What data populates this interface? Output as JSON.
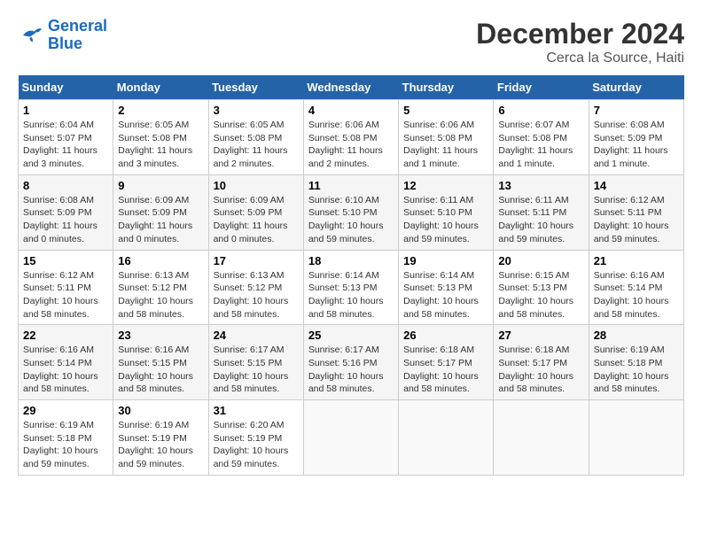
{
  "header": {
    "logo_line1": "General",
    "logo_line2": "Blue",
    "month": "December 2024",
    "location": "Cerca la Source, Haiti"
  },
  "days_of_week": [
    "Sunday",
    "Monday",
    "Tuesday",
    "Wednesday",
    "Thursday",
    "Friday",
    "Saturday"
  ],
  "weeks": [
    [
      {
        "num": "1",
        "sunrise": "6:04 AM",
        "sunset": "5:07 PM",
        "daylight": "11 hours and 3 minutes."
      },
      {
        "num": "2",
        "sunrise": "6:05 AM",
        "sunset": "5:08 PM",
        "daylight": "11 hours and 3 minutes."
      },
      {
        "num": "3",
        "sunrise": "6:05 AM",
        "sunset": "5:08 PM",
        "daylight": "11 hours and 2 minutes."
      },
      {
        "num": "4",
        "sunrise": "6:06 AM",
        "sunset": "5:08 PM",
        "daylight": "11 hours and 2 minutes."
      },
      {
        "num": "5",
        "sunrise": "6:06 AM",
        "sunset": "5:08 PM",
        "daylight": "11 hours and 1 minute."
      },
      {
        "num": "6",
        "sunrise": "6:07 AM",
        "sunset": "5:08 PM",
        "daylight": "11 hours and 1 minute."
      },
      {
        "num": "7",
        "sunrise": "6:08 AM",
        "sunset": "5:09 PM",
        "daylight": "11 hours and 1 minute."
      }
    ],
    [
      {
        "num": "8",
        "sunrise": "6:08 AM",
        "sunset": "5:09 PM",
        "daylight": "11 hours and 0 minutes."
      },
      {
        "num": "9",
        "sunrise": "6:09 AM",
        "sunset": "5:09 PM",
        "daylight": "11 hours and 0 minutes."
      },
      {
        "num": "10",
        "sunrise": "6:09 AM",
        "sunset": "5:09 PM",
        "daylight": "11 hours and 0 minutes."
      },
      {
        "num": "11",
        "sunrise": "6:10 AM",
        "sunset": "5:10 PM",
        "daylight": "10 hours and 59 minutes."
      },
      {
        "num": "12",
        "sunrise": "6:11 AM",
        "sunset": "5:10 PM",
        "daylight": "10 hours and 59 minutes."
      },
      {
        "num": "13",
        "sunrise": "6:11 AM",
        "sunset": "5:11 PM",
        "daylight": "10 hours and 59 minutes."
      },
      {
        "num": "14",
        "sunrise": "6:12 AM",
        "sunset": "5:11 PM",
        "daylight": "10 hours and 59 minutes."
      }
    ],
    [
      {
        "num": "15",
        "sunrise": "6:12 AM",
        "sunset": "5:11 PM",
        "daylight": "10 hours and 58 minutes."
      },
      {
        "num": "16",
        "sunrise": "6:13 AM",
        "sunset": "5:12 PM",
        "daylight": "10 hours and 58 minutes."
      },
      {
        "num": "17",
        "sunrise": "6:13 AM",
        "sunset": "5:12 PM",
        "daylight": "10 hours and 58 minutes."
      },
      {
        "num": "18",
        "sunrise": "6:14 AM",
        "sunset": "5:13 PM",
        "daylight": "10 hours and 58 minutes."
      },
      {
        "num": "19",
        "sunrise": "6:14 AM",
        "sunset": "5:13 PM",
        "daylight": "10 hours and 58 minutes."
      },
      {
        "num": "20",
        "sunrise": "6:15 AM",
        "sunset": "5:13 PM",
        "daylight": "10 hours and 58 minutes."
      },
      {
        "num": "21",
        "sunrise": "6:16 AM",
        "sunset": "5:14 PM",
        "daylight": "10 hours and 58 minutes."
      }
    ],
    [
      {
        "num": "22",
        "sunrise": "6:16 AM",
        "sunset": "5:14 PM",
        "daylight": "10 hours and 58 minutes."
      },
      {
        "num": "23",
        "sunrise": "6:16 AM",
        "sunset": "5:15 PM",
        "daylight": "10 hours and 58 minutes."
      },
      {
        "num": "24",
        "sunrise": "6:17 AM",
        "sunset": "5:15 PM",
        "daylight": "10 hours and 58 minutes."
      },
      {
        "num": "25",
        "sunrise": "6:17 AM",
        "sunset": "5:16 PM",
        "daylight": "10 hours and 58 minutes."
      },
      {
        "num": "26",
        "sunrise": "6:18 AM",
        "sunset": "5:17 PM",
        "daylight": "10 hours and 58 minutes."
      },
      {
        "num": "27",
        "sunrise": "6:18 AM",
        "sunset": "5:17 PM",
        "daylight": "10 hours and 58 minutes."
      },
      {
        "num": "28",
        "sunrise": "6:19 AM",
        "sunset": "5:18 PM",
        "daylight": "10 hours and 58 minutes."
      }
    ],
    [
      {
        "num": "29",
        "sunrise": "6:19 AM",
        "sunset": "5:18 PM",
        "daylight": "10 hours and 59 minutes."
      },
      {
        "num": "30",
        "sunrise": "6:19 AM",
        "sunset": "5:19 PM",
        "daylight": "10 hours and 59 minutes."
      },
      {
        "num": "31",
        "sunrise": "6:20 AM",
        "sunset": "5:19 PM",
        "daylight": "10 hours and 59 minutes."
      },
      null,
      null,
      null,
      null
    ]
  ],
  "labels": {
    "sunrise": "Sunrise:",
    "sunset": "Sunset:",
    "daylight": "Daylight hours"
  }
}
